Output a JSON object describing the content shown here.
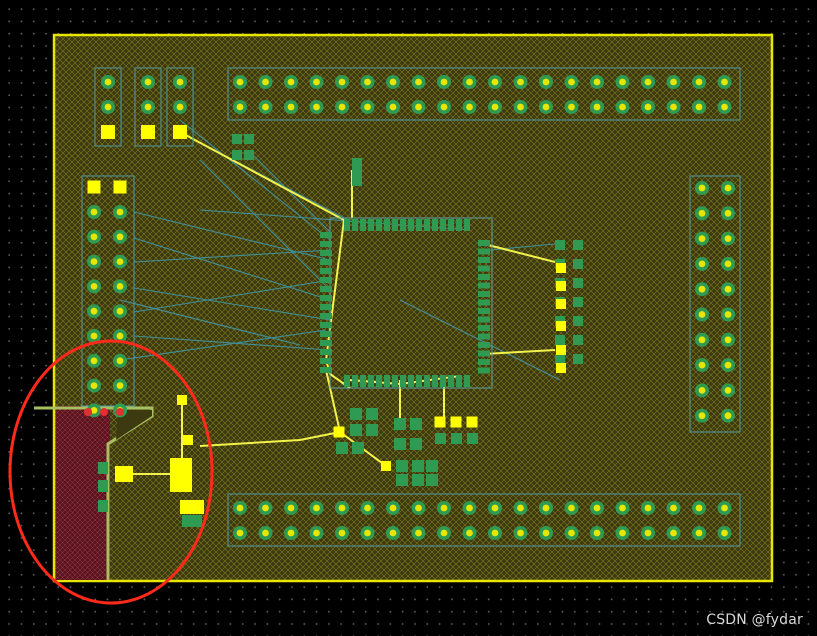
{
  "watermark": "CSDN @fydar",
  "colors": {
    "board_fill": "#3d3a12",
    "board_outline": "#e6e600",
    "copper_pour_hatch": "#8a8a1e",
    "pad_ring_green": "#2f9a52",
    "pad_hole_yellow": "#e6e600",
    "smd_pad_yellow": "#ffff00",
    "ratsnest_teal": "#3e8f9a",
    "trace_yellow": "#f2f24a",
    "keepout_red_fill": "#6a1a24",
    "highlight_circle_red": "#ff2a1a"
  },
  "icons": {
    "through_hole_pad": "through-hole-pad-icon",
    "smd_pad": "smd-pad-icon",
    "mcu": "qfp-chip-icon"
  }
}
